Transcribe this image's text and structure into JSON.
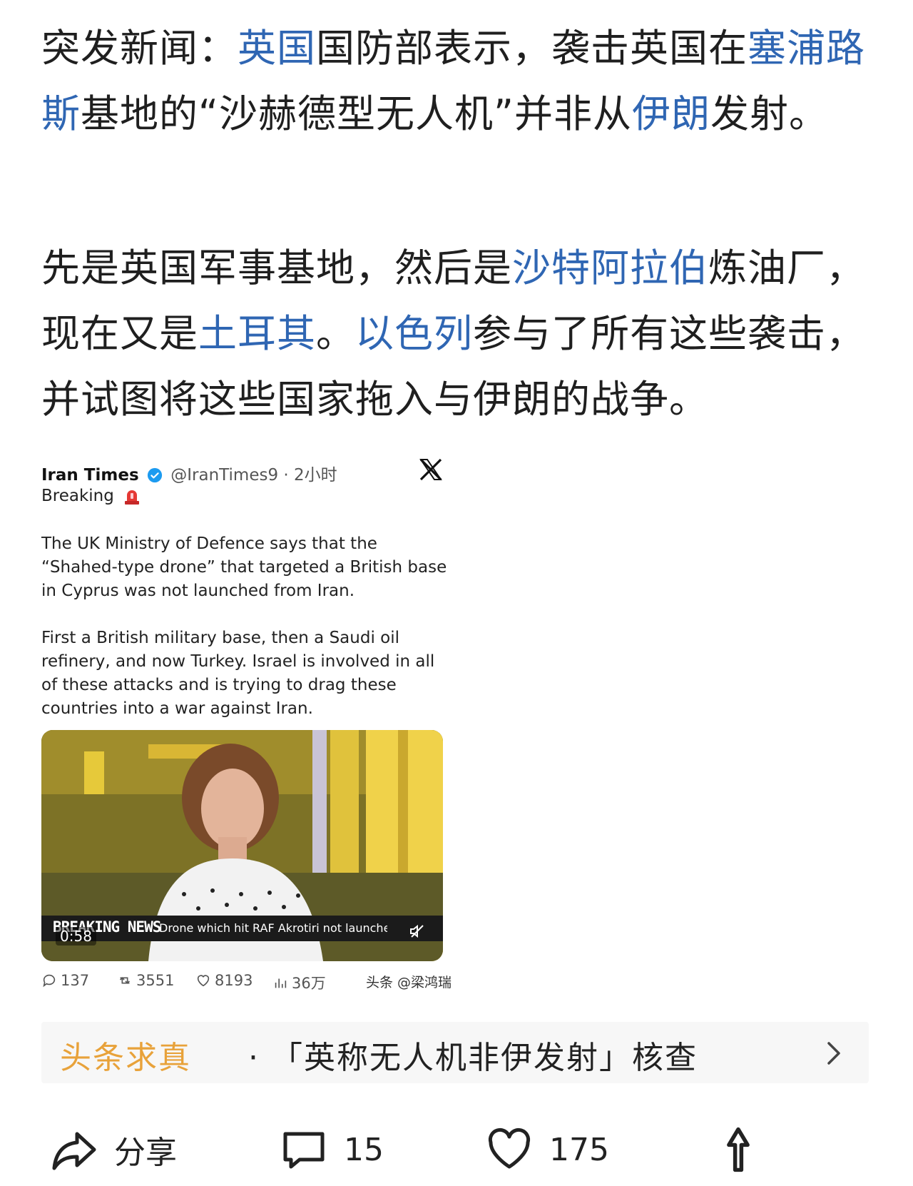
{
  "post": {
    "p1": {
      "s1": "突发新闻：",
      "l1": "英国",
      "s2": "国防部表示，袭击英国在",
      "l2": "塞浦路斯",
      "s3": "基地的“沙赫德型无人机”并非从",
      "l3": "伊朗",
      "s4": "发射。"
    },
    "p2": {
      "s1": "先是英国军事基地，然后是",
      "l1": "沙特阿拉伯",
      "s2": "炼油厂，现在又是",
      "l2": "土耳其",
      "s3": "。",
      "l3": "以色列",
      "s4": "参与了所有这些袭击，并试图将这些国家拖入与伊朗的战争。"
    }
  },
  "tweet": {
    "name": "Iran Times",
    "handle": "@IranTimes9 · 2小时",
    "sub": "Breaking",
    "body1": "The UK Ministry of Defence says that the “Shahed-type drone” that targeted a British base in Cyprus was not launched from Iran.",
    "body2": "First a British military base, then a Saudi oil refinery, and now Turkey. Israel is involved in all of these attacks and is trying to drag these countries into a war against Iran.",
    "video": {
      "ticker_label": "BREAKING NEWS",
      "ticker_text": "Drone which hit RAF Akrotiri not launched from Ir",
      "duration": "0:58"
    },
    "stats": {
      "replies": "137",
      "retweets": "3551",
      "likes": "8193",
      "views": "36万"
    },
    "watermark": "头条 @梁鸿瑞"
  },
  "factcheck": {
    "brand": "头条求真",
    "title": "· 「英称无人机非伊发射」核查"
  },
  "actions": {
    "share": "分享",
    "comments": "15",
    "likes": "175"
  },
  "icons": {
    "verified": "verified-badge-icon",
    "x_logo": "x-logo-icon",
    "siren": "siren-icon",
    "reply": "reply-icon",
    "retweet": "retweet-icon",
    "like": "heart-icon",
    "views": "views-icon",
    "mute": "mute-icon",
    "chevron": "chevron-right-icon",
    "share": "share-icon",
    "comment": "comment-icon",
    "thumb": "thumbs-up-icon"
  },
  "colors": {
    "link": "#2f66b3",
    "fact_brand": "#e8a23a",
    "verified": "#1d9bf0"
  }
}
